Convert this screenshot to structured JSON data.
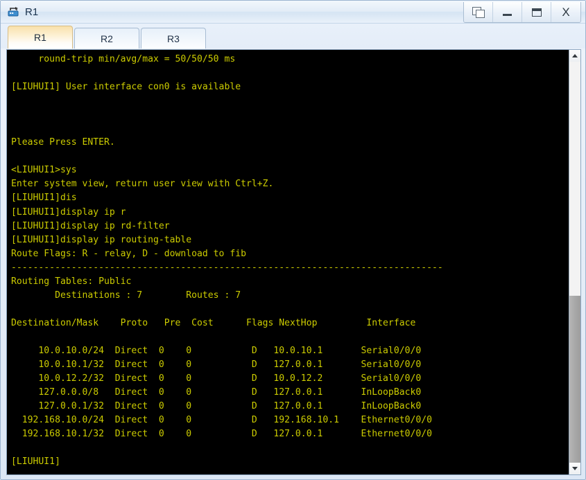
{
  "window": {
    "title": "R1",
    "icon": "router-icon",
    "controls": [
      {
        "name": "restore-windows-button",
        "label": ""
      },
      {
        "name": "minimize-button",
        "label": ""
      },
      {
        "name": "maximize-button",
        "label": ""
      },
      {
        "name": "close-button",
        "label": "X"
      }
    ],
    "close_label": "X"
  },
  "tabs": [
    {
      "label": "R1",
      "active": true
    },
    {
      "label": "R2",
      "active": false
    },
    {
      "label": "R3",
      "active": false
    }
  ],
  "terminal": {
    "colors": {
      "background": "#000000",
      "text": "#cccc00"
    },
    "content": "     round-trip min/avg/max = 50/50/50 ms\n\n[LIUHUI1] User interface con0 is available\n\n\n\nPlease Press ENTER.\n\n<LIUHUI1>sys\nEnter system view, return user view with Ctrl+Z.\n[LIUHUI1]dis\n[LIUHUI1]display ip r\n[LIUHUI1]display ip rd-filter\n[LIUHUI1]display ip routing-table\nRoute Flags: R - relay, D - download to fib\n-------------------------------------------------------------------------------\nRouting Tables: Public\n        Destinations : 7        Routes : 7\n\nDestination/Mask    Proto   Pre  Cost      Flags NextHop         Interface\n\n     10.0.10.0/24  Direct  0    0           D   10.0.10.1       Serial0/0/0\n     10.0.10.1/32  Direct  0    0           D   127.0.0.1       Serial0/0/0\n     10.0.12.2/32  Direct  0    0           D   10.0.12.2       Serial0/0/0\n     127.0.0.0/8   Direct  0    0           D   127.0.0.1       InLoopBack0\n     127.0.0.1/32  Direct  0    0           D   127.0.0.1       InLoopBack0\n  192.168.10.0/24  Direct  0    0           D   192.168.10.1    Ethernet0/0/0\n  192.168.10.1/32  Direct  0    0           D   127.0.0.1       Ethernet0/0/0\n\n[LIUHUI1]",
    "session": {
      "ping_summary": "     round-trip min/avg/max = 50/50/50 ms",
      "user_interface_msg": "[LIUHUI1] User interface con0 is available",
      "press_enter": "Please Press ENTER.",
      "prompt_user": "<LIUHUI1>",
      "prompt_system": "[LIUHUI1]",
      "commands": [
        "sys",
        "dis",
        "display ip r",
        "display ip rd-filter",
        "display ip routing-table"
      ],
      "system_view_msg": "Enter system view, return user view with Ctrl+Z.",
      "route_flags": "Route Flags: R - relay, D - download to fib",
      "separator": "-------------------------------------------------------------------------------",
      "routing_tables_label": "Routing Tables: Public",
      "destinations_count": "7",
      "routes_count": "7",
      "counts_line": "        Destinations : 7        Routes : 7",
      "final_prompt": "[LIUHUI1]"
    },
    "routing_table": {
      "headers": [
        "Destination/Mask",
        "Proto",
        "Pre",
        "Cost",
        "Flags",
        "NextHop",
        "Interface"
      ],
      "rows": [
        [
          "10.0.10.0/24",
          "Direct",
          "0",
          "0",
          "D",
          "10.0.10.1",
          "Serial0/0/0"
        ],
        [
          "10.0.10.1/32",
          "Direct",
          "0",
          "0",
          "D",
          "127.0.0.1",
          "Serial0/0/0"
        ],
        [
          "10.0.12.2/32",
          "Direct",
          "0",
          "0",
          "D",
          "10.0.12.2",
          "Serial0/0/0"
        ],
        [
          "127.0.0.0/8",
          "Direct",
          "0",
          "0",
          "D",
          "127.0.0.1",
          "InLoopBack0"
        ],
        [
          "127.0.0.1/32",
          "Direct",
          "0",
          "0",
          "D",
          "127.0.0.1",
          "InLoopBack0"
        ],
        [
          "192.168.10.0/24",
          "Direct",
          "0",
          "0",
          "D",
          "192.168.10.1",
          "Ethernet0/0/0"
        ],
        [
          "192.168.10.1/32",
          "Direct",
          "0",
          "0",
          "D",
          "127.0.0.1",
          "Ethernet0/0/0"
        ]
      ]
    }
  },
  "scrollbar": {
    "up_icon": "chevron-up-icon",
    "down_icon": "chevron-down-icon"
  }
}
